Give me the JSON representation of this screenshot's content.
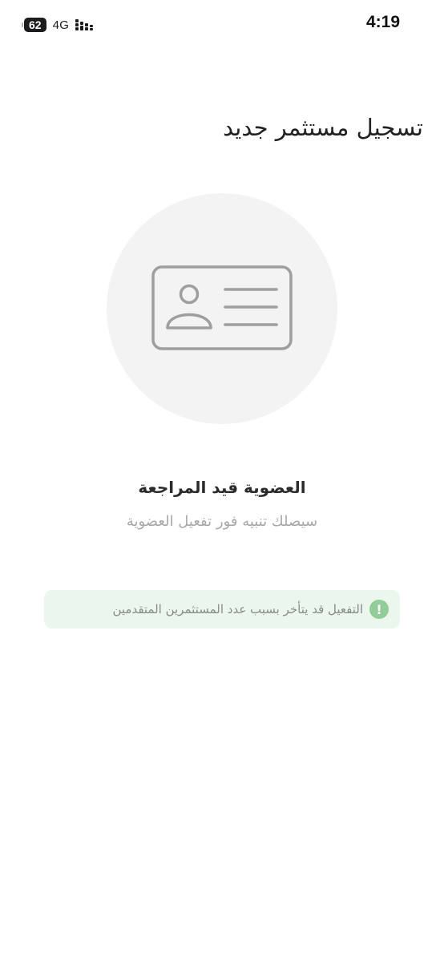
{
  "status_bar": {
    "battery": "62",
    "network": "4G",
    "time": "4:19"
  },
  "header": {
    "title": "تسجيل مستثمر جديد"
  },
  "illustration": {
    "icon": "id-card-icon"
  },
  "status": {
    "title": "العضوية قيد المراجعة",
    "subtitle": "سيصلك تنبيه فور تفعيل العضوية"
  },
  "notice": {
    "icon": "info-icon",
    "icon_glyph": "!",
    "text": "التفعيل قد يتأخر بسبب عدد المستثمرين المتقدمين",
    "background": "#ebf6ec",
    "accent": "#92cc98"
  }
}
